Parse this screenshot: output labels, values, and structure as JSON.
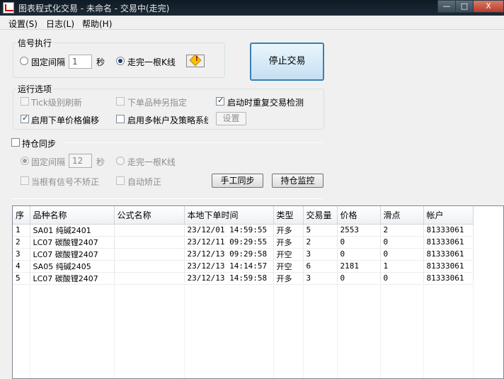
{
  "window": {
    "title": "图表程式化交易 - 未命名 - 交易中(走完)",
    "min_glyph": "—",
    "max_glyph": "□",
    "close_glyph": "X"
  },
  "menu": [
    {
      "label": "设置(S)"
    },
    {
      "label": "日志(L)"
    },
    {
      "label": "帮助(H)"
    }
  ],
  "signal": {
    "group_label": "信号执行",
    "fixed_interval_label": "固定间隔",
    "interval_value": "1",
    "seconds_label": "秒",
    "bar_close_label": "走完一根K线",
    "mode_selected": "bar_close",
    "stop_button_label": "停止交易"
  },
  "options": {
    "group_label": "运行选项",
    "tick_refresh_label": "Tick级别刷新",
    "tick_refresh_checked": false,
    "order_other_label": "下单品种另指定",
    "order_other_checked": false,
    "restart_check_label": "启动时重复交易检测",
    "restart_check_checked": true,
    "price_offset_label": "启用下单价格偏移",
    "price_offset_checked": true,
    "multi_account_label": "启用多帐户及策略系统",
    "multi_account_checked": false,
    "settings_button_label": "设置"
  },
  "position_sync": {
    "label": "持仓同步",
    "checked": false,
    "fixed_interval_label": "固定间隔",
    "interval_value": "12",
    "seconds_label": "秒",
    "bar_close_label": "走完一根K线",
    "mode_selected": "fixed",
    "no_correct_label": "当根有信号不矫正",
    "auto_correct_label": "自动矫正",
    "manual_sync_label": "手工同步",
    "monitor_label": "持仓监控"
  },
  "table": {
    "columns": [
      "序",
      "品种名称",
      "公式名称",
      "本地下单时间",
      "类型",
      "交易量",
      "价格",
      "滑点",
      "帐户"
    ],
    "rows": [
      [
        "1",
        "SA01 纯碱2401",
        "",
        "23/12/01 14:59:55",
        "开多",
        "5",
        "2553",
        "2",
        "81333061"
      ],
      [
        "2",
        "LC07 碳酸锂2407",
        "",
        "23/12/11 09:29:55",
        "开多",
        "2",
        "0",
        "0",
        "81333061"
      ],
      [
        "3",
        "LC07 碳酸锂2407",
        "",
        "23/12/13 09:29:58",
        "开空",
        "3",
        "0",
        "0",
        "81333061"
      ],
      [
        "4",
        "SA05 纯碱2405",
        "",
        "23/12/13 14:14:57",
        "开空",
        "6",
        "2181",
        "1",
        "81333061"
      ],
      [
        "5",
        "LC07 碳酸锂2407",
        "",
        "23/12/13 14:59:58",
        "开多",
        "3",
        "0",
        "0",
        "81333061"
      ]
    ]
  }
}
